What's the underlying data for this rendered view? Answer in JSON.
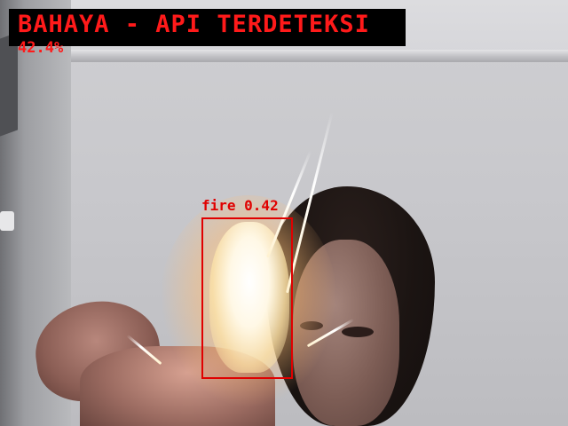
{
  "alert": {
    "title": "BAHAYA - API TERDETEKSI",
    "confidence": "42.4%"
  },
  "detections": [
    {
      "label": "fire 0.42",
      "class": "fire",
      "score": 0.42
    }
  ],
  "colors": {
    "alert_text": "#ff1a1a",
    "alert_bg": "#000000",
    "box": "#e00000"
  },
  "icons": [
    "flame-glow"
  ]
}
